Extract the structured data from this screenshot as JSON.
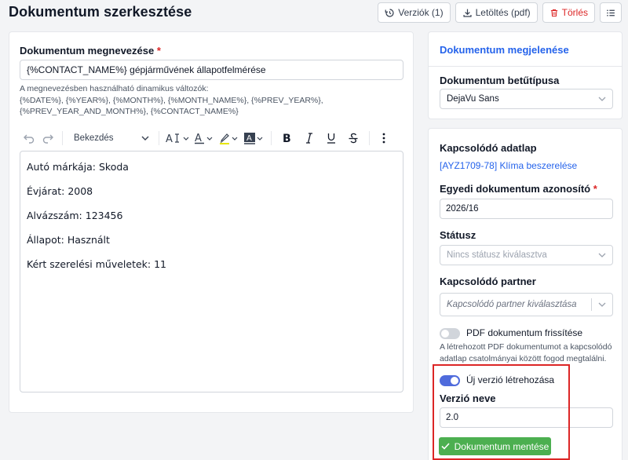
{
  "header": {
    "title": "Dokumentum szerkesztése",
    "versions_label": "Verziók (1)",
    "download_label": "Letöltés (pdf)",
    "delete_label": "Törlés"
  },
  "document": {
    "name_label": "Dokumentum megnevezése",
    "name_value": "{%CONTACT_NAME%} gépjárművének állapotfelmérése",
    "hint_line1": "A megnevezésben használható dinamikus változók:",
    "hint_line2": "{%DATE%}, {%YEAR%}, {%MONTH%}, {%MONTH_NAME%}, {%PREV_YEAR%},",
    "hint_line3": "{%PREV_YEAR_AND_MONTH%}, {%CONTACT_NAME%}"
  },
  "toolbar": {
    "heading_select": "Bekezdés"
  },
  "editor": {
    "paragraphs": [
      "Autó márkája: Skoda",
      "Évjárat: 2008",
      "Alvázszám: 123456",
      "Állapot: Használt",
      "Kért szerelési műveletek: 11"
    ]
  },
  "appearance": {
    "title": "Dokumentum megjelenése",
    "font_label": "Dokumentum betűtípusa",
    "font_value": "DejaVu Sans"
  },
  "meta": {
    "related_sheet_label": "Kapcsolódó adatlap",
    "related_sheet_link": "[AYZ1709-78] Klíma beszerelése",
    "custom_id_label": "Egyedi dokumentum azonosító",
    "custom_id_value": "2026/16",
    "status_label": "Státusz",
    "status_placeholder": "Nincs státusz kiválasztva",
    "partner_label": "Kapcsolódó partner",
    "partner_placeholder": "Kapcsolódó partner kiválasztása",
    "pdf_refresh_label": "PDF dokumentum frissítése",
    "pdf_refresh_on": false,
    "pdf_help_line1": "A létrehozott PDF dokumentumot a kapcsolódó",
    "pdf_help_line2": "adatlap csatolmányai között fogod megtalálni.",
    "new_version_label": "Új verzió létrehozása",
    "new_version_on": true,
    "version_name_label": "Verzió neve",
    "version_name_value": "2.0",
    "save_label": "Dokumentum mentése"
  },
  "colors": {
    "accent": "#2563eb",
    "toggle_on": "#4f6bdc",
    "save": "#4caf50",
    "danger": "#dc2626",
    "highlight": "#dc2626"
  }
}
